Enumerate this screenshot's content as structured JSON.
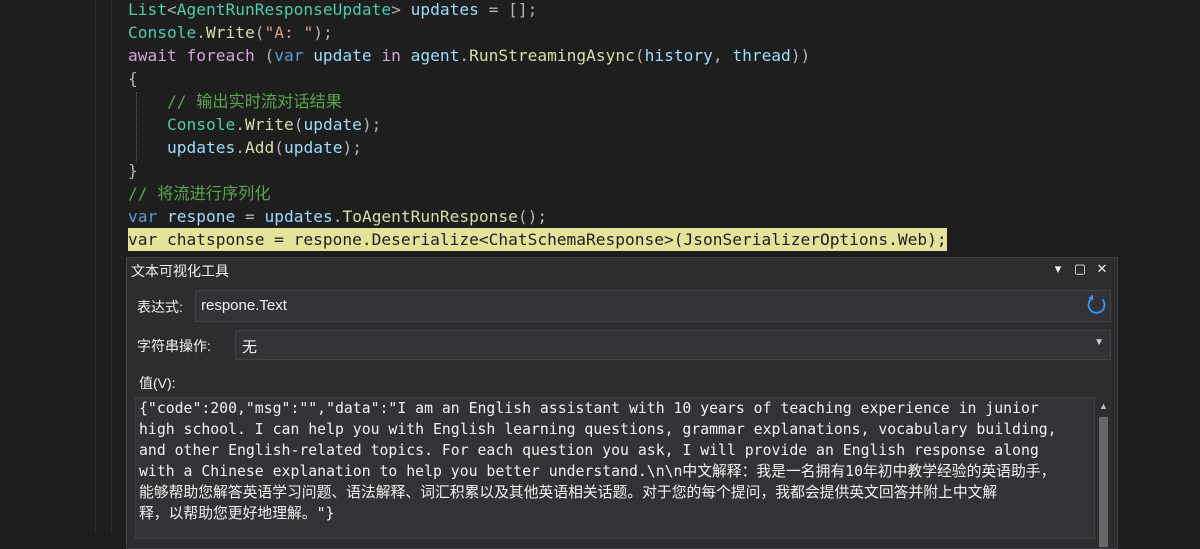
{
  "editor": {
    "lines": [
      {
        "id": "line-list",
        "tokens": [
          [
            "List",
            "type"
          ],
          [
            "<",
            "punc"
          ],
          [
            "AgentRunResponseUpdate",
            "type"
          ],
          [
            "> ",
            "punc"
          ],
          [
            "updates",
            "var"
          ],
          [
            " = [];",
            "punc"
          ]
        ]
      },
      {
        "id": "line-write-a",
        "tokens": [
          [
            "Console",
            "type"
          ],
          [
            ".",
            "punc"
          ],
          [
            "Write",
            "method"
          ],
          [
            "(",
            "punc"
          ],
          [
            "\"A: \"",
            "str"
          ],
          [
            ");",
            "punc"
          ]
        ]
      },
      {
        "id": "line-foreach",
        "tokens": [
          [
            "await ",
            "kw2"
          ],
          [
            "foreach ",
            "kw2"
          ],
          [
            "(",
            "punc"
          ],
          [
            "var ",
            "kw"
          ],
          [
            "update ",
            "var"
          ],
          [
            "in ",
            "kw2"
          ],
          [
            "agent",
            "var"
          ],
          [
            ".",
            "punc"
          ],
          [
            "RunStreamingAsync",
            "method"
          ],
          [
            "(",
            "punc"
          ],
          [
            "history",
            "var"
          ],
          [
            ", ",
            "punc"
          ],
          [
            "thread",
            "var"
          ],
          [
            "))",
            "punc"
          ]
        ]
      },
      {
        "id": "line-open-brace",
        "tokens": [
          [
            "{",
            "punc"
          ]
        ]
      },
      {
        "id": "line-comment-output",
        "tokens": [
          [
            "    // 输出实时流对话结果",
            "cmt"
          ]
        ]
      },
      {
        "id": "line-write-update",
        "tokens": [
          [
            "    ",
            "punc"
          ],
          [
            "Console",
            "type"
          ],
          [
            ".",
            "punc"
          ],
          [
            "Write",
            "method"
          ],
          [
            "(",
            "punc"
          ],
          [
            "update",
            "var"
          ],
          [
            ");",
            "punc"
          ]
        ]
      },
      {
        "id": "line-add-update",
        "tokens": [
          [
            "    ",
            "punc"
          ],
          [
            "updates",
            "var"
          ],
          [
            ".",
            "punc"
          ],
          [
            "Add",
            "method"
          ],
          [
            "(",
            "punc"
          ],
          [
            "update",
            "var"
          ],
          [
            ");",
            "punc"
          ]
        ]
      },
      {
        "id": "line-close-brace",
        "tokens": [
          [
            "}",
            "punc"
          ]
        ]
      },
      {
        "id": "line-comment-serialize",
        "tokens": [
          [
            "// 将流进行序列化",
            "cmt"
          ]
        ]
      },
      {
        "id": "line-respone",
        "tokens": [
          [
            "var ",
            "kw"
          ],
          [
            "respone",
            "var"
          ],
          [
            " = ",
            "punc"
          ],
          [
            "updates",
            "var"
          ],
          [
            ".",
            "punc"
          ],
          [
            "ToAgentRunResponse",
            "method"
          ],
          [
            "();",
            "punc"
          ]
        ]
      },
      {
        "id": "line-chatsponse",
        "highlight": true,
        "tokens": [
          [
            "var chatsponse = respone.Deserialize<ChatSchemaResponse>(JsonSerializerOptions.Web);",
            "punc"
          ]
        ]
      }
    ]
  },
  "visualizer": {
    "title": "文本可视化工具",
    "expression_label": "表达式:",
    "expression_value": "respone.Text",
    "operation_label": "字符串操作:",
    "operation_value": "无",
    "value_label": "值(V):",
    "value_lines": [
      "{\"code\":200,\"msg\":\"\",\"data\":\"I am an English assistant with 10 years of teaching experience in junior",
      "high school. I can help you with English learning questions, grammar explanations, vocabulary building,",
      "and other English-related topics. For each question you ask, I will provide an English response along",
      "with a Chinese explanation to help you better understand.\\n\\n中文解释：我是一名拥有10年初中教学经验的英语助手，",
      "能够帮助您解答英语学习问题、语法解释、词汇积累以及其他英语相关话题。对于您的每个提问，我都会提供英文回答并附上中文解",
      "释，以帮助您更好地理解。\"}"
    ],
    "window_buttons": {
      "dropdown": "▾",
      "maximize": "▢",
      "close": "✕"
    },
    "icons": {
      "refresh": "refresh-icon",
      "select_arrow": "chevron-down-icon",
      "scroll_up": "scroll-up-arrow-icon"
    }
  },
  "colors": {
    "editor_bg": "#1e1e1e",
    "highlight": "#e4e39a",
    "refresh_accent": "#3794ff"
  }
}
